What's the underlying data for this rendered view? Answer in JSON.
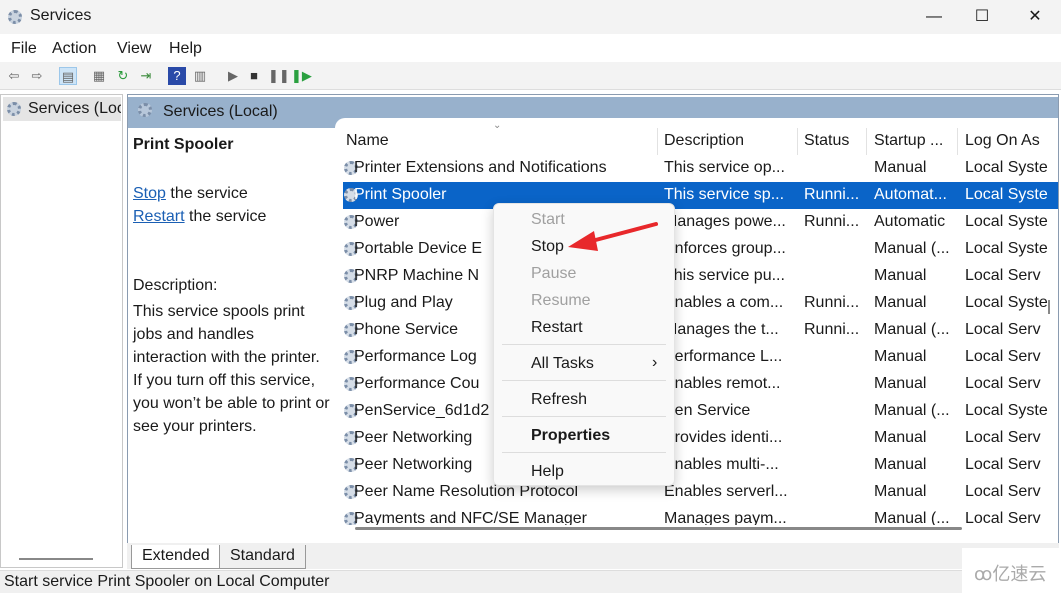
{
  "window": {
    "title": "Services",
    "minimize": "—",
    "maximize": "☐",
    "close": "✕"
  },
  "menu": [
    "File",
    "Action",
    "View",
    "Help"
  ],
  "toolbar_icons": [
    "back-icon",
    "forward-icon",
    "show-hide-tree-icon",
    "properties-icon",
    "refresh-icon",
    "export-list-icon",
    "help-icon",
    "console-icon",
    "start-icon",
    "stop-icon",
    "pause-icon",
    "restart-icon"
  ],
  "tree": {
    "item": "Services (Loc"
  },
  "header": {
    "title": "Services (Local)"
  },
  "desc": {
    "service_name": "Print Spooler",
    "stop_link": "Stop",
    "stop_suffix": " the service",
    "restart_link": "Restart",
    "restart_suffix": " the service",
    "label": "Description:",
    "text": "This service spools print jobs and handles interaction with the printer.  If you turn off this service, you won’t be able to print or see your printers."
  },
  "columns": [
    "Name",
    "Description",
    "Status",
    "Startup ...",
    "Log On As"
  ],
  "rows": [
    [
      "Printer Extensions and Notifications",
      "This service op...",
      "",
      "Manual",
      "Local Syste"
    ],
    [
      "Print Spooler",
      "This service sp...",
      "Runni...",
      "Automat...",
      "Local Syste"
    ],
    [
      "Power",
      "Manages powe...",
      "Runni...",
      "Automatic",
      "Local Syste"
    ],
    [
      "Portable Device E",
      "Enforces group...",
      "",
      "Manual (...",
      "Local Syste"
    ],
    [
      "PNRP Machine N",
      "This service pu...",
      "",
      "Manual",
      "Local Serv"
    ],
    [
      "Plug and Play",
      "Enables a com...",
      "Runni...",
      "Manual",
      "Local Syste"
    ],
    [
      "Phone Service",
      "Manages the t...",
      "Runni...",
      "Manual (...",
      "Local Serv"
    ],
    [
      "Performance Log",
      "Performance L...",
      "",
      "Manual",
      "Local Serv"
    ],
    [
      "Performance Cou",
      "Enables remot...",
      "",
      "Manual",
      "Local Serv"
    ],
    [
      "PenService_6d1d2",
      "Pen Service",
      "",
      "Manual (...",
      "Local Syste"
    ],
    [
      "Peer Networking",
      "Provides identi...",
      "",
      "Manual",
      "Local Serv"
    ],
    [
      "Peer Networking",
      "Enables multi-...",
      "",
      "Manual",
      "Local Serv"
    ],
    [
      "Peer Name Resolution Protocol",
      "Enables serverl...",
      "",
      "Manual",
      "Local Serv"
    ],
    [
      "Payments and NFC/SE Manager",
      "Manages paym...",
      "",
      "Manual (...",
      "Local Serv"
    ]
  ],
  "context_menu": {
    "start": "Start",
    "stop": "Stop",
    "pause": "Pause",
    "resume": "Resume",
    "restart": "Restart",
    "all_tasks": "All Tasks",
    "submenu_arrow": "›",
    "refresh": "Refresh",
    "properties": "Properties",
    "help": "Help"
  },
  "tabs": [
    "Extended",
    "Standard"
  ],
  "status": "Start service Print Spooler on Local Computer",
  "watermark": "亿速云",
  "colors": {
    "selection": "#0a64c8",
    "header_bar": "#98b1cc",
    "arrow": "#e8282b"
  }
}
